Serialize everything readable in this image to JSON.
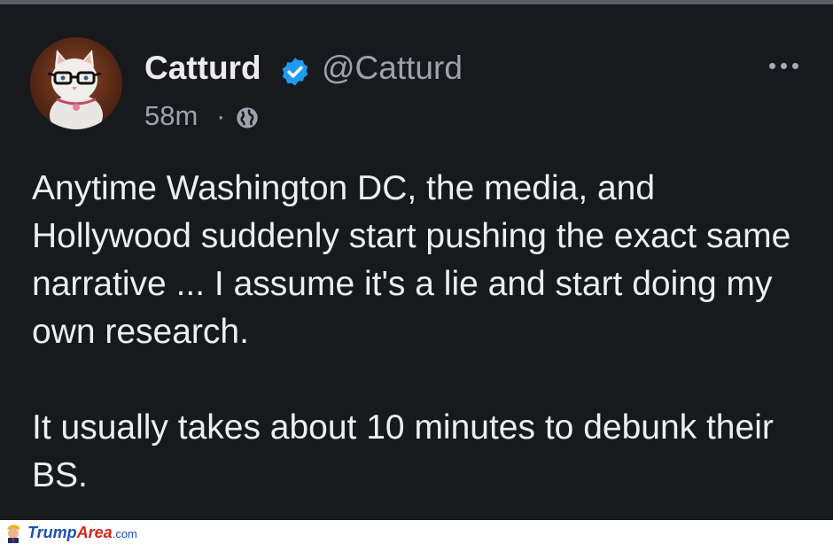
{
  "post": {
    "author": {
      "display_name": "Catturd",
      "handle": "@Catturd",
      "verified": true,
      "avatar_icon": "cat-with-glasses-avatar"
    },
    "meta": {
      "time_ago": "58m",
      "separator": "·",
      "visibility_icon": "globe-icon"
    },
    "more_icon": "more-horizontal-icon",
    "body_paragraphs": [
      "Anytime Washington DC, the media, and Hollywood suddenly start pushing the exact same narrative ... I assume it's a lie and start doing my own research.",
      "It usually takes about 10 minutes to debunk their BS."
    ]
  },
  "watermark": {
    "brand_part1": "Trump",
    "brand_part2": "Area",
    "brand_suffix": ".com"
  },
  "colors": {
    "background": "#18191d",
    "text_primary": "#eceef0",
    "text_secondary": "#9ea2aa",
    "verified_blue": "#1d9bf0",
    "watermark_blue": "#1d4fb5",
    "watermark_red": "#d4251c"
  }
}
